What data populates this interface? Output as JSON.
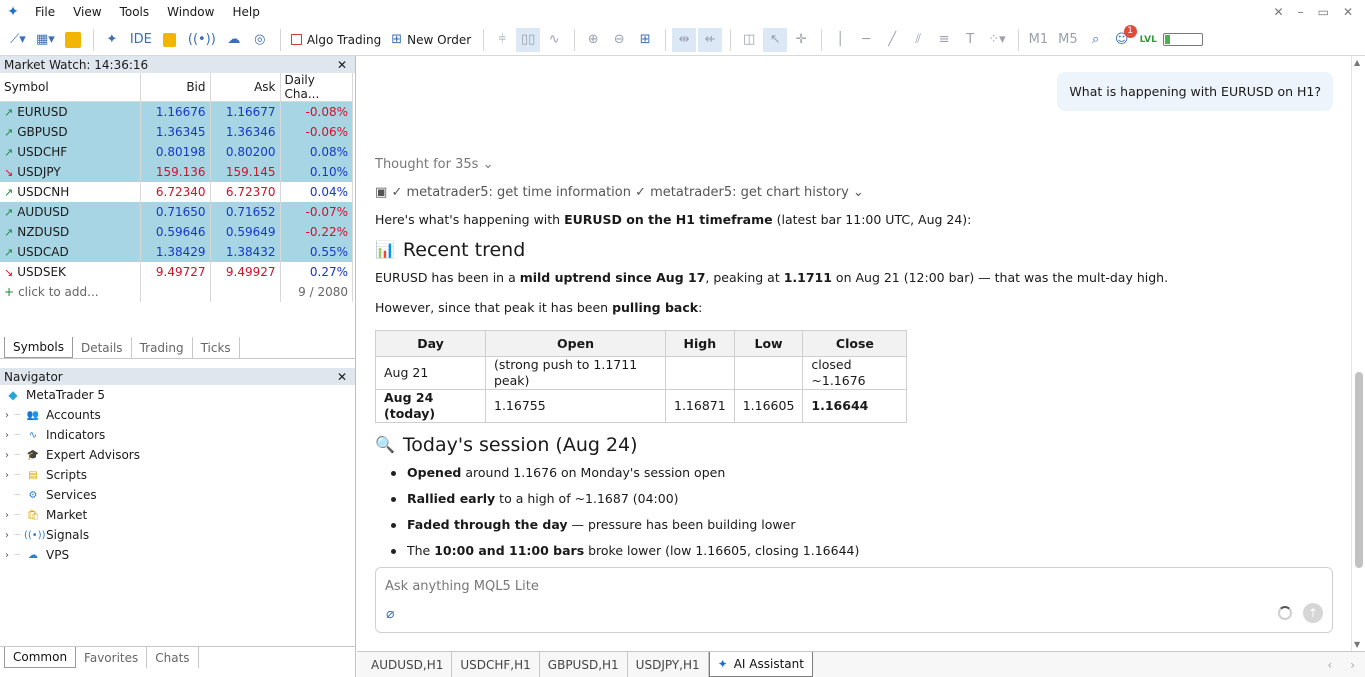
{
  "menu": [
    "File",
    "View",
    "Tools",
    "Window",
    "Help"
  ],
  "toolbar": {
    "ide": "IDE",
    "algo_trading": "Algo Trading",
    "new_order": "New Order",
    "tf1": "M1",
    "tf2": "M5",
    "notif_count": "1",
    "lvl": "LVL"
  },
  "market_watch": {
    "title": "Market Watch: 14:36:16",
    "columns": [
      "Symbol",
      "Bid",
      "Ask",
      "Daily Cha..."
    ],
    "rows": [
      {
        "symbol": "EURUSD",
        "bid": "1.16676",
        "ask": "1.16677",
        "change": "-0.08%",
        "dir": "up",
        "hl": true,
        "color": "blue",
        "chg_color": "red"
      },
      {
        "symbol": "GBPUSD",
        "bid": "1.36345",
        "ask": "1.36346",
        "change": "-0.06%",
        "dir": "up",
        "hl": true,
        "color": "blue",
        "chg_color": "red"
      },
      {
        "symbol": "USDCHF",
        "bid": "0.80198",
        "ask": "0.80200",
        "change": "0.08%",
        "dir": "up",
        "hl": true,
        "color": "blue",
        "chg_color": "blue"
      },
      {
        "symbol": "USDJPY",
        "bid": "159.136",
        "ask": "159.145",
        "change": "0.10%",
        "dir": "down",
        "hl": true,
        "color": "red",
        "chg_color": "blue"
      },
      {
        "symbol": "USDCNH",
        "bid": "6.72340",
        "ask": "6.72370",
        "change": "0.04%",
        "dir": "up",
        "hl": false,
        "color": "red",
        "chg_color": "blue"
      },
      {
        "symbol": "AUDUSD",
        "bid": "0.71650",
        "ask": "0.71652",
        "change": "-0.07%",
        "dir": "up",
        "hl": true,
        "color": "blue",
        "chg_color": "red"
      },
      {
        "symbol": "NZDUSD",
        "bid": "0.59646",
        "ask": "0.59649",
        "change": "-0.22%",
        "dir": "up",
        "hl": true,
        "color": "blue",
        "chg_color": "red"
      },
      {
        "symbol": "USDCAD",
        "bid": "1.38429",
        "ask": "1.38432",
        "change": "0.55%",
        "dir": "up",
        "hl": true,
        "color": "blue",
        "chg_color": "blue"
      },
      {
        "symbol": "USDSEK",
        "bid": "9.49727",
        "ask": "9.49927",
        "change": "0.27%",
        "dir": "down",
        "hl": false,
        "color": "red",
        "chg_color": "blue"
      }
    ],
    "add_text": "click to add...",
    "count": "9 / 2080",
    "tabs": [
      "Symbols",
      "Details",
      "Trading",
      "Ticks"
    ]
  },
  "navigator": {
    "title": "Navigator",
    "root": "MetaTrader 5",
    "items": [
      {
        "label": "Accounts",
        "icon": "accounts-icon",
        "expand": true
      },
      {
        "label": "Indicators",
        "icon": "indicators-icon",
        "expand": true
      },
      {
        "label": "Expert Advisors",
        "icon": "expert-advisors-icon",
        "expand": true
      },
      {
        "label": "Scripts",
        "icon": "scripts-icon",
        "expand": true
      },
      {
        "label": "Services",
        "icon": "services-icon",
        "expand": false
      },
      {
        "label": "Market",
        "icon": "market-icon",
        "expand": true
      },
      {
        "label": "Signals",
        "icon": "signals-icon",
        "expand": true
      },
      {
        "label": "VPS",
        "icon": "vps-icon",
        "expand": true
      }
    ],
    "tabs": [
      "Common",
      "Favorites",
      "Chats"
    ]
  },
  "chat": {
    "user_message": "What is happening with EURUSD on H1?",
    "thought": "Thought for 35s",
    "tools_line": "✓ metatrader5: get time information ✓ metatrader5: get chart history",
    "intro_pre": "Here's what's happening with ",
    "intro_bold": "EURUSD on the H1 timeframe",
    "intro_post": " (latest bar 11:00 UTC, Aug 24):",
    "h_trend": "Recent trend",
    "trend_p1_a": "EURUSD has been in a ",
    "trend_p1_b": "mild uptrend since Aug 17",
    "trend_p1_c": ", peaking at ",
    "trend_p1_d": "1.1711",
    "trend_p1_e": " on Aug 21 (12:00 bar) — that was the mult-day high.",
    "trend_p2_a": "However, since that peak it has been ",
    "trend_p2_b": "pulling back",
    "trend_p2_c": ":",
    "table": {
      "headers": [
        "Day",
        "Open",
        "High",
        "Low",
        "Close"
      ],
      "rows": [
        [
          "Aug 21",
          "(strong push to 1.1711 peak)",
          "",
          "",
          "closed ~1.1676"
        ],
        [
          "Aug 24 (today)",
          "1.16755",
          "1.16871",
          "1.16605",
          "1.16644"
        ]
      ]
    },
    "h_session": "Today's session (Aug 24)",
    "bullets": [
      {
        "b": "Opened",
        "t": " around 1.1676 on Monday's session open"
      },
      {
        "b": "Rallied early",
        "t": " to a high of ~1.1687 (04:00)"
      },
      {
        "b": "Faded through the day",
        "t": " — pressure has been building lower"
      },
      {
        "pre": "The ",
        "b": "10:00 and 11:00 bars",
        "t": " broke lower (low 1.16605, closing 1.16644)"
      }
    ],
    "input_placeholder": "Ask anything MQL5 Lite"
  },
  "bottom_tabs": [
    "AUDUSD,H1",
    "USDCHF,H1",
    "GBPUSD,H1",
    "USDJPY,H1",
    "AI Assistant"
  ]
}
